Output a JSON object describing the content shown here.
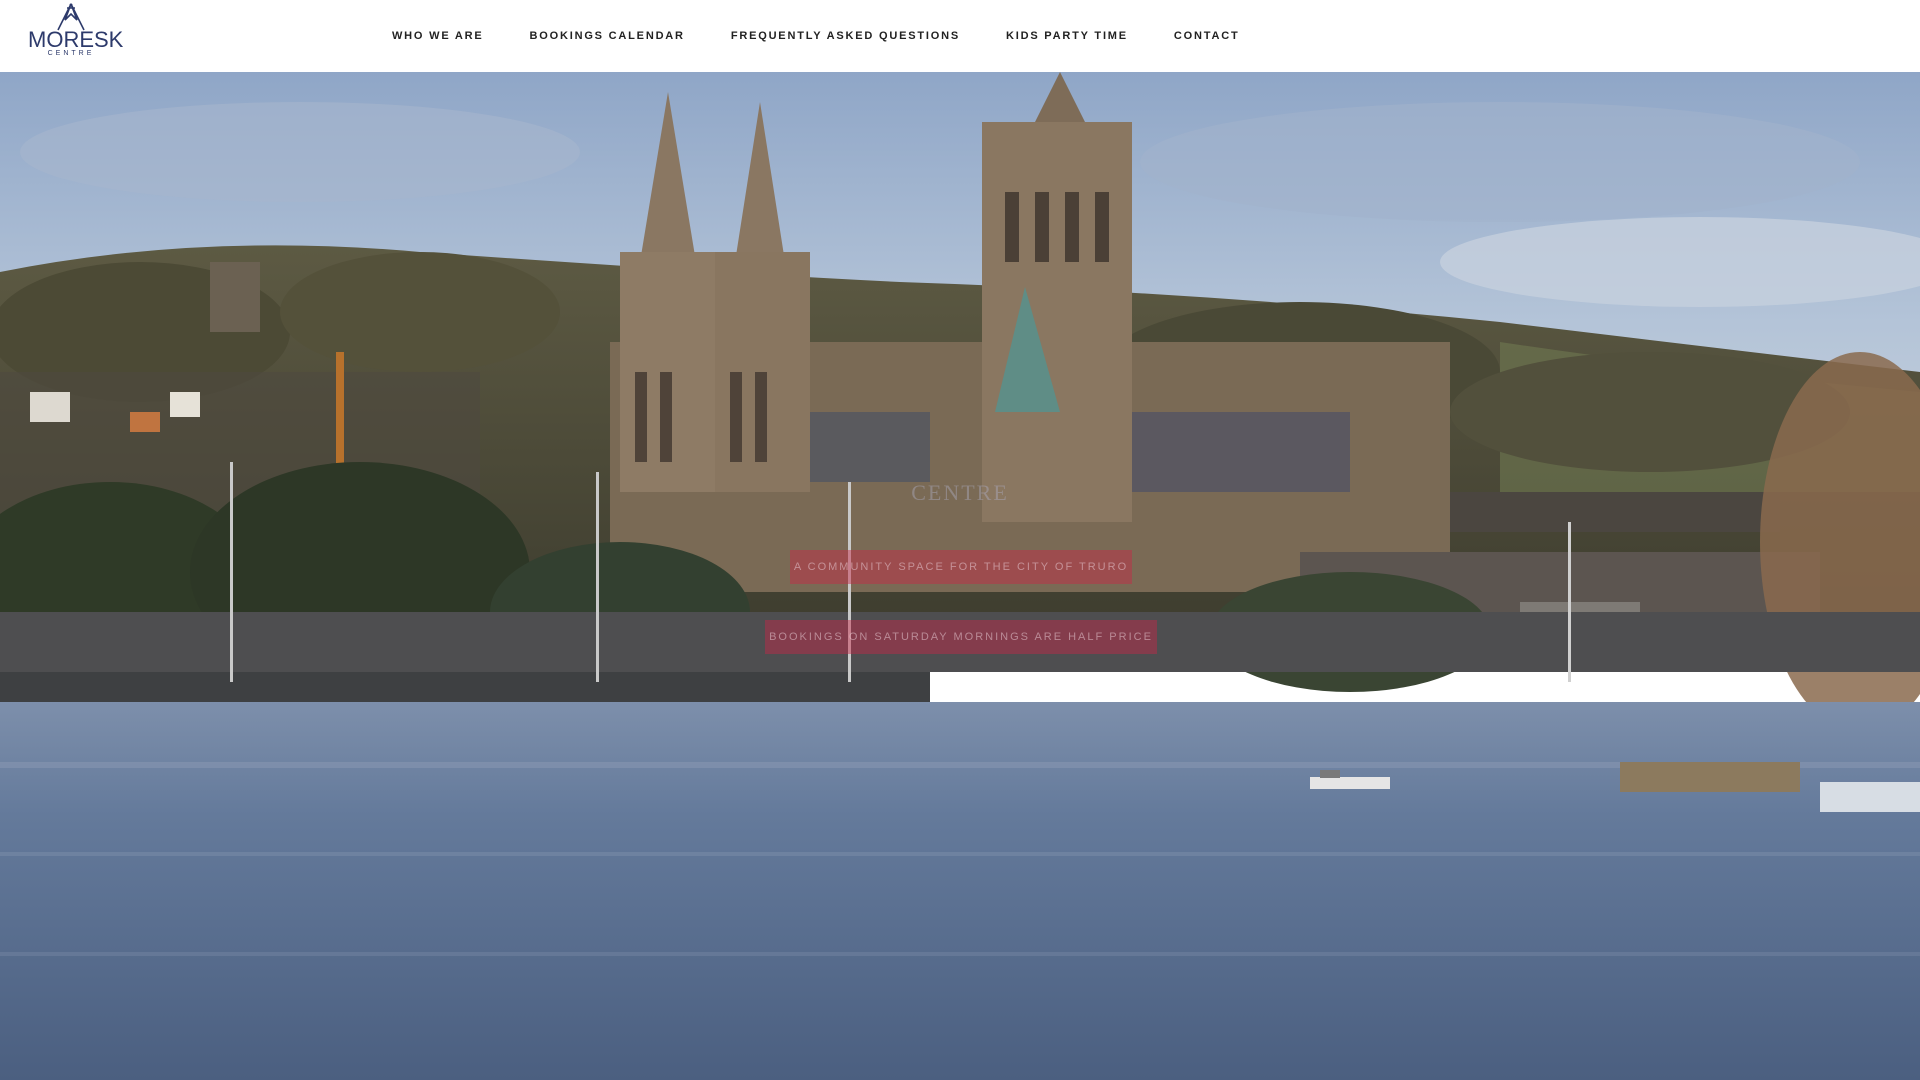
{
  "header": {
    "logo": {
      "name": "MORESK",
      "sub": "CENTRE"
    },
    "nav": [
      {
        "label": "WHO WE ARE"
      },
      {
        "label": "BOOKINGS CALENDAR"
      },
      {
        "label": "FREQUENTLY ASKED QUESTIONS"
      },
      {
        "label": "KIDS PARTY TIME"
      },
      {
        "label": "CONTACT"
      }
    ]
  },
  "hero": {
    "heading": "CENTRE",
    "tagline": "A COMMUNITY SPACE FOR THE CITY OF TRURO",
    "cta": "BOOKINGS ON SATURDAY MORNINGS ARE HALF PRICE"
  },
  "colors": {
    "brand_navy": "#2d3a6b",
    "accent_red": "#c82846",
    "nav_text": "#222222"
  }
}
